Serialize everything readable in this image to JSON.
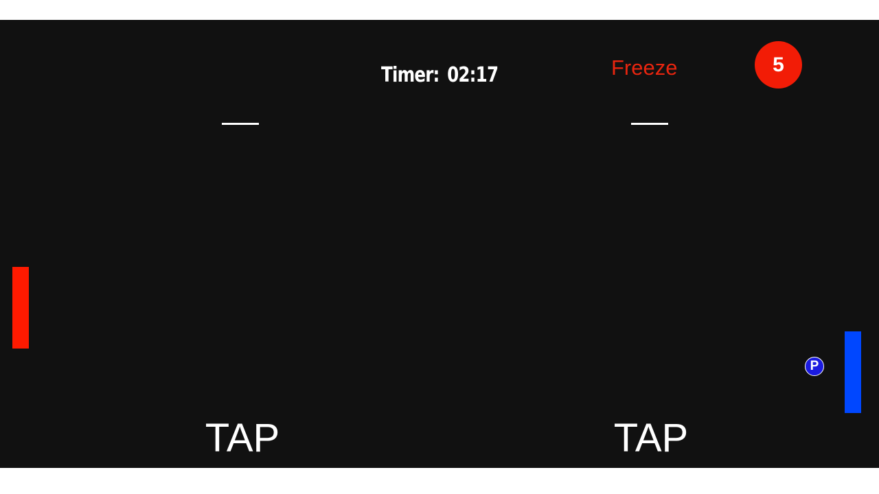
{
  "hud": {
    "timer_label": "Timer:",
    "timer_value": "02:17",
    "freeze_label": "Freeze",
    "freeze_count": "5"
  },
  "powerup": {
    "label": "P"
  },
  "controls": {
    "left_tap": "TAP",
    "right_tap": "TAP"
  },
  "colors": {
    "background": "#111111",
    "player_left": "#ff1a00",
    "player_right": "#0047ff",
    "freeze_text": "#e8250f",
    "freeze_badge": "#f21c06",
    "powerup_fill": "#1b1be0"
  }
}
